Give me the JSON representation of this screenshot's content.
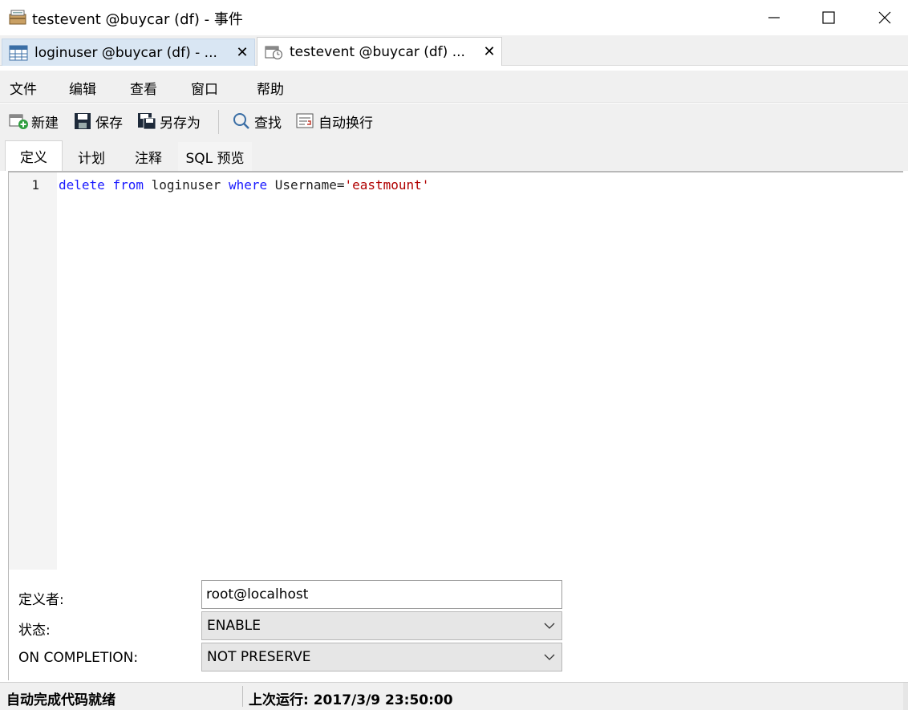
{
  "window": {
    "title": "testevent @buycar (df) - 事件"
  },
  "doc_tabs": [
    {
      "label": "loginuser @buycar (df) - ...",
      "close": "✕",
      "icon": "table-icon"
    },
    {
      "label": "testevent @buycar (df) ...",
      "close": "✕",
      "icon": "event-icon"
    }
  ],
  "menu": [
    "文件",
    "编辑",
    "查看",
    "窗口",
    "帮助"
  ],
  "toolbar": {
    "new": "新建",
    "save": "保存",
    "save_as": "另存为",
    "find": "查找",
    "word_wrap": "自动换行"
  },
  "inner_tabs": [
    "定义",
    "计划",
    "注释",
    "SQL 预览"
  ],
  "editor": {
    "line_number": "1",
    "tokens": {
      "delete": "delete",
      "from": "from",
      "table": "loginuser",
      "where": "where",
      "condition": "Username=",
      "value": "'eastmount'"
    }
  },
  "form": {
    "definer_label": "定义者:",
    "definer_value": "root@localhost",
    "status_label": "状态:",
    "status_value": "ENABLE",
    "on_completion_label": "ON COMPLETION:",
    "on_completion_value": "NOT PRESERVE"
  },
  "statusbar": {
    "left": "自动完成代码就绪",
    "right": "上次运行: 2017/3/9 23:50:00"
  }
}
